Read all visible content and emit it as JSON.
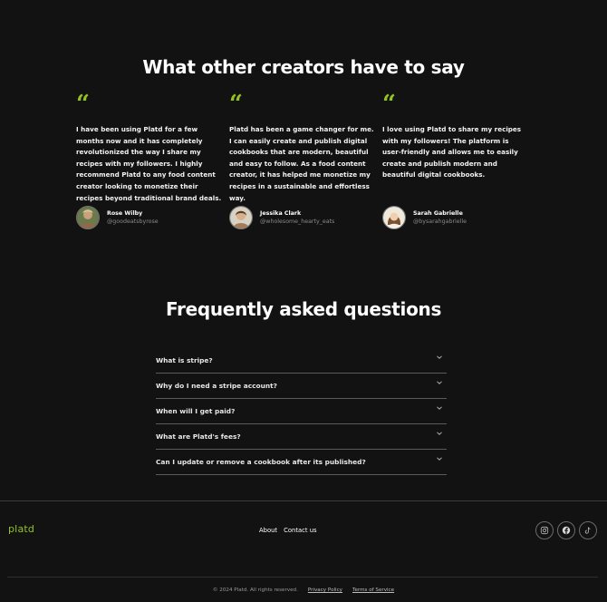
{
  "testimonials": {
    "title": "What other creators have to say",
    "quote_glyph": "“",
    "items": [
      {
        "quote": "I have been using Platd for a few months now and it has completely revolutionized the way I share my recipes with my followers. I highly recommend Platd to any food content creator looking to monetize their recipes beyond traditional brand deals.",
        "name": "Rose Wilby",
        "handle": "@goodeatsbyrose"
      },
      {
        "quote": "Platd has been a game changer for me. I can easily create and publish digital cookbooks that are modern, beautiful and easy to follow. As a food content creator, it has helped me monetize my recipes in a sustainable and effortless way.",
        "name": "Jessika Clark",
        "handle": "@wholesome_hearty_eats"
      },
      {
        "quote": "I love using Platd to share my recipes with my followers! The platform is user-friendly and allows me to easily create and publish modern and beautiful digital cookbooks.",
        "name": "Sarah Gabrielle",
        "handle": "@bysarahgabrielle"
      }
    ]
  },
  "faq": {
    "title": "Frequently asked questions",
    "items": [
      "What is stripe?",
      "Why do I need a stripe account?",
      "When will I get paid?",
      "What are Platd's fees?",
      "Can I update or remove a cookbook after its published?"
    ]
  },
  "footer": {
    "logo": "platd",
    "nav": [
      "About",
      "Contact us"
    ],
    "socials": [
      "instagram-icon",
      "facebook-icon",
      "tiktok-icon"
    ],
    "copyright": "© 2024 Platd. All rights reserved.",
    "privacy": "Privacy Policy",
    "terms": "Terms of Service"
  },
  "colors": {
    "background": "#121212",
    "accent": "#93c321",
    "text": "#ffffff",
    "muted": "#8a8a8a"
  }
}
